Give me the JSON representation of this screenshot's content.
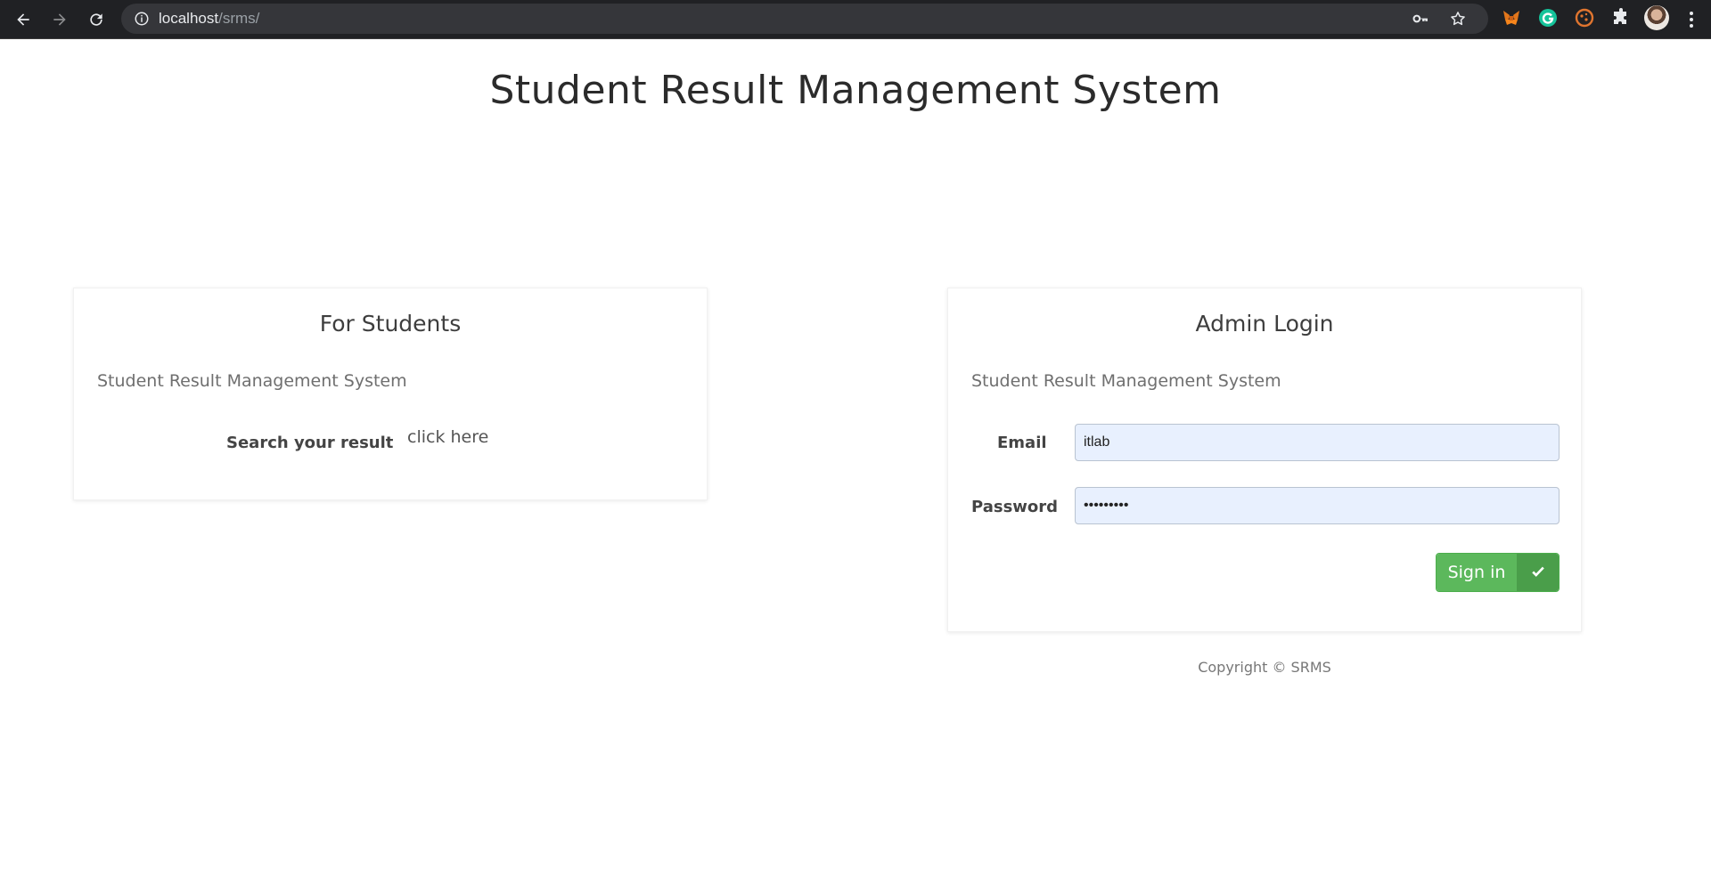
{
  "browser": {
    "url_host": "localhost",
    "url_path": "/srms/"
  },
  "page": {
    "title": "Student Result Management System"
  },
  "students_card": {
    "title": "For Students",
    "subtitle": "Student Result Management System",
    "search_label": "Search your result",
    "link_label": "click here"
  },
  "admin_card": {
    "title": "Admin Login",
    "subtitle": "Student Result Management System",
    "email_label": "Email",
    "email_value": "itlab",
    "password_label": "Password",
    "password_value": "itlab1234",
    "signin_label": "Sign in"
  },
  "footer": {
    "copyright": "Copyright © SRMS"
  },
  "colors": {
    "signin_green": "#5cb85c",
    "autofill_blue": "#e8f0fe"
  }
}
